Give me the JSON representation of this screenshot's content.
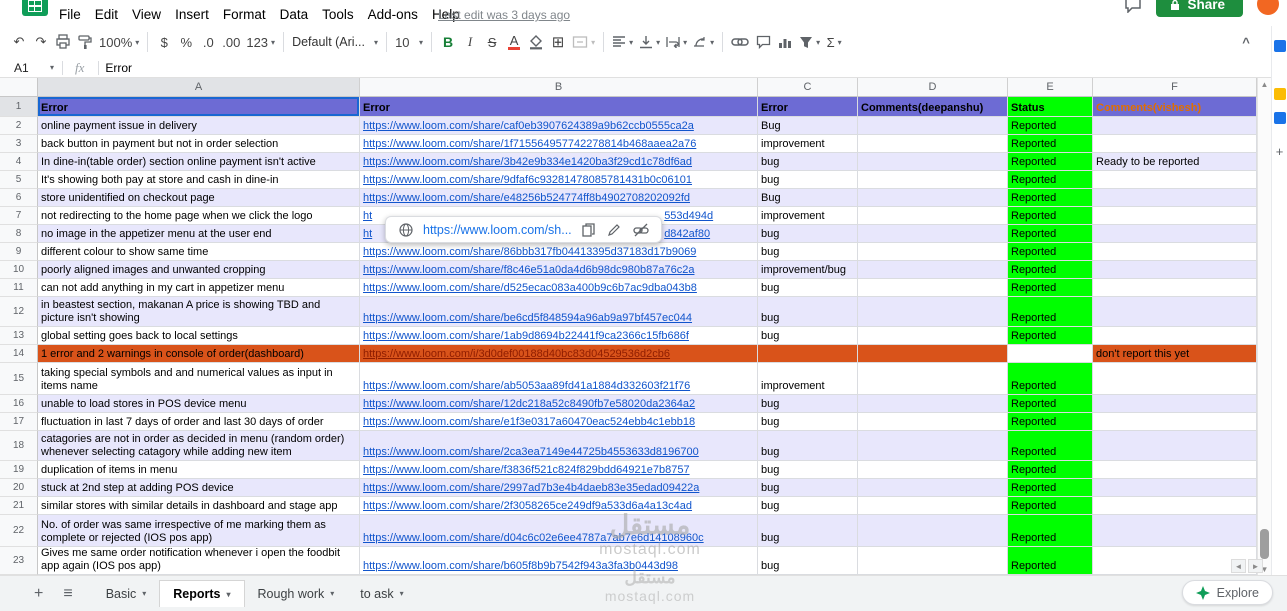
{
  "menu": {
    "items": [
      "File",
      "Edit",
      "View",
      "Insert",
      "Format",
      "Data",
      "Tools",
      "Add-ons",
      "Help"
    ],
    "last_edit": "Last edit was 3 days ago"
  },
  "topbar": {
    "share_label": "Share"
  },
  "toolbar": {
    "zoom": "100%",
    "currency": "$",
    "percent": "%",
    "decimal_decrease": ".0",
    "decimal_increase": ".00",
    "more_formats": "123",
    "font": "Default (Ari...",
    "font_size": "10",
    "bold": "B",
    "italic": "I",
    "strikethrough": "S",
    "text_color": "A",
    "sigma": "Σ",
    "collapse": "^"
  },
  "formula_bar": {
    "cell_ref": "A1",
    "fx_label": "fx",
    "value": "Error"
  },
  "grid": {
    "column_letters": [
      "A",
      "B",
      "C",
      "D",
      "E",
      "F"
    ],
    "header_row": {
      "n": 1,
      "a": "Error",
      "b": "Error",
      "c": "Error",
      "d": "Comments(deepanshu)",
      "e": "Status",
      "f": "Comments(vishesh)"
    },
    "rows": [
      {
        "n": 2,
        "a": "online payment issue in delivery",
        "b": "https://www.loom.com/share/caf0eb3907624389a9b62ccb0555ca2a",
        "c": "Bug",
        "d": "",
        "e": "Reported",
        "f": ""
      },
      {
        "n": 3,
        "a": "back button in payment but not in order selection",
        "b": "https://www.loom.com/share/1f715564957742278814b468aaea2a76",
        "c": "improvement",
        "d": "",
        "e": "Reported",
        "f": ""
      },
      {
        "n": 4,
        "a": "In dine-in(table order) section online payment isn't active",
        "b": "https://www.loom.com/share/3b42e9b334e1420ba3f29cd1c78df6ad",
        "c": "bug",
        "d": "",
        "e": "Reported",
        "f": "Ready to be reported"
      },
      {
        "n": 5,
        "a": "It's showing both pay at store and cash in dine-in",
        "b": "https://www.loom.com/share/9dfaf6c93281478085781431b0c06101",
        "c": "bug",
        "d": "",
        "e": "Reported",
        "f": ""
      },
      {
        "n": 6,
        "a": "store unidentified on checkout page",
        "b": "https://www.loom.com/share/e48256b524774ff8b4902708202092fd",
        "c": "Bug",
        "d": "",
        "e": "Reported",
        "f": ""
      },
      {
        "n": 7,
        "a": "not redirecting to the home page when we click the logo",
        "b_prefix": "ht",
        "b_suffix": "553d494d",
        "c": "improvement",
        "d": "",
        "e": "Reported",
        "f": ""
      },
      {
        "n": 8,
        "a": "no image in the appetizer menu at the user end",
        "b_prefix": "ht",
        "b_suffix": "d842af80",
        "c": "bug",
        "d": "",
        "e": "Reported",
        "f": ""
      },
      {
        "n": 9,
        "a": "different colour to show same time",
        "b": "https://www.loom.com/share/86bbb317fb04413395d37183d17b9069",
        "c": "bug",
        "d": "",
        "e": "Reported",
        "f": ""
      },
      {
        "n": 10,
        "a": "poorly aligned images and unwanted cropping",
        "b": "https://www.loom.com/share/f8c46e51a0da4d6b98dc980b87a76c2a",
        "c": "improvement/bug",
        "d": "",
        "e": "Reported",
        "f": ""
      },
      {
        "n": 11,
        "a": "can not add anything in my cart in appetizer menu",
        "b": "https://www.loom.com/share/d525ecac083a400b9c6b7ac9dba043b8",
        "c": "bug",
        "d": "",
        "e": "Reported",
        "f": ""
      },
      {
        "n": 12,
        "a": "in beastest section, makanan A price is showing TBD and picture isn't showing",
        "b": "https://www.loom.com/share/be6cd5f848594a96ab9a97bf457ec044",
        "c": "bug",
        "d": "",
        "e": "Reported",
        "f": ""
      },
      {
        "n": 13,
        "a": "global setting goes back to local settings",
        "b": "https://www.loom.com/share/1ab9d8694b22441f9ca2366c15fb686f",
        "c": "bug",
        "d": "",
        "e": "Reported",
        "f": ""
      },
      {
        "n": 14,
        "a": "1 error and 2 warnings in console of order(dashboard)",
        "b": "https://www.loom.com/i/3d0def00188d40bc83d04529536d2cb6",
        "c": "",
        "d": "",
        "e": "",
        "f": "don't report this yet",
        "highlight": "orange"
      },
      {
        "n": 15,
        "a": "taking special symbols and and numerical values as input in items name",
        "b": "https://www.loom.com/share/ab5053aa89fd41a1884d332603f21f76",
        "c": "improvement",
        "d": "",
        "e": "Reported",
        "f": ""
      },
      {
        "n": 16,
        "a": "unable to load stores in POS device menu",
        "b": "https://www.loom.com/share/12dc218a52c8490fb7e58020da2364a2",
        "c": "bug",
        "d": "",
        "e": "Reported",
        "f": ""
      },
      {
        "n": 17,
        "a": "fluctuation in last 7 days of order and last 30 days of order",
        "b": "https://www.loom.com/share/e1f3e0317a60470eac524ebb4c1ebb18",
        "c": "bug",
        "d": "",
        "e": "Reported",
        "f": ""
      },
      {
        "n": 18,
        "a": "catagories are not in order as decided in menu (random order) whenever selecting catagory while adding new item",
        "b": "https://www.loom.com/share/2ca3ea7149e44725b4553633d8196700",
        "c": "bug",
        "d": "",
        "e": "Reported",
        "f": ""
      },
      {
        "n": 19,
        "a": "duplication of items in menu",
        "b": "https://www.loom.com/share/f3836f521c824f829bdd64921e7b8757",
        "c": "bug",
        "d": "",
        "e": "Reported",
        "f": ""
      },
      {
        "n": 20,
        "a": "stuck at 2nd step at adding POS device",
        "b": "https://www.loom.com/share/2997ad7b3e4b4daeb83e35edad09422a",
        "c": "bug",
        "d": "",
        "e": "Reported",
        "f": ""
      },
      {
        "n": 21,
        "a": "similar stores with similar details in dashboard and stage app",
        "b": "https://www.loom.com/share/2f3058265ce249df9a533d6a4a13c4ad",
        "c": "bug",
        "d": "",
        "e": "Reported",
        "f": ""
      },
      {
        "n": 22,
        "a": "No. of order was same irrespective  of me marking them as complete or rejected (IOS pos app)",
        "b": "https://www.loom.com/share/d04c6c02e6ee4787a7ab7e6d14108960c",
        "c": "bug",
        "d": "",
        "e": "Reported",
        "f": ""
      },
      {
        "n": 23,
        "a": "Gives me same order notification whenever i open the foodbit app again (IOS pos app)",
        "b": "https://www.loom.com/share/b605f8b9b7542f943a3fa3b0443d98",
        "c": "bug",
        "d": "",
        "e": "Reported",
        "f": ""
      }
    ]
  },
  "link_tooltip": {
    "url": "https://www.loom.com/sh..."
  },
  "sheet_tabs": {
    "tabs": [
      {
        "label": "Basic",
        "active": false
      },
      {
        "label": "Reports",
        "active": true
      },
      {
        "label": "Rough work",
        "active": false
      },
      {
        "label": "to ask",
        "active": false
      }
    ],
    "explore_label": "Explore"
  },
  "watermark": {
    "line1": "مستقل",
    "line2": "mostaql.com"
  },
  "colors": {
    "header_row_bg": "#6d6bd4",
    "band_row_bg": "#e8e7fc",
    "status_green": "#00ff00",
    "highlight_row_orange": "#d9531a",
    "link_blue": "#1155cc",
    "share_button_green": "#1e8e3e",
    "header_f_text_orange": "#e06f00",
    "avatar_orange": "#f26722"
  }
}
